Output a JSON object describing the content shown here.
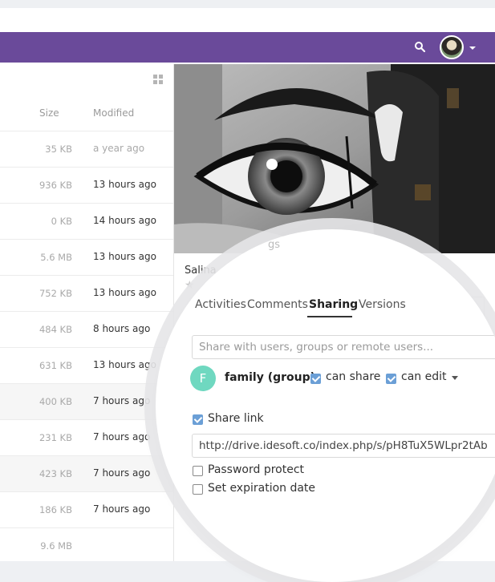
{
  "header": {
    "search_icon": "search-icon",
    "avatar_icon": "user-avatar",
    "menu_icon": "chevron-down-icon",
    "bar_color": "#6a4a9a"
  },
  "file_list": {
    "columns": {
      "size": "Size",
      "modified": "Modified"
    },
    "rows": [
      {
        "size": "35 KB",
        "modified": "a year ago"
      },
      {
        "size": "936 KB",
        "modified": "13 hours ago"
      },
      {
        "size": "0 KB",
        "modified": "14 hours ago"
      },
      {
        "size": "5.6 MB",
        "modified": "13 hours ago"
      },
      {
        "size": "752 KB",
        "modified": "13 hours ago"
      },
      {
        "size": "484 KB",
        "modified": "8 hours ago"
      },
      {
        "size": "631 KB",
        "modified": "13 hours ago"
      },
      {
        "size": "400 KB",
        "modified": "7 hours ago"
      },
      {
        "size": "231 KB",
        "modified": "7 hours ago"
      },
      {
        "size": "423 KB",
        "modified": "7 hours ago"
      },
      {
        "size": "186 KB",
        "modified": "7 hours ago"
      },
      {
        "size": "9.6 MB",
        "modified": ""
      }
    ]
  },
  "details": {
    "file_name": "Salina",
    "ghost_title": "gs",
    "star_icon": "star-icon",
    "tabs": [
      {
        "label": "Activities"
      },
      {
        "label": "Comments"
      },
      {
        "label": "Sharing"
      },
      {
        "label": "Versions"
      }
    ],
    "active_tab": "Sharing"
  },
  "sharing": {
    "share_placeholder": "Share with users, groups or remote users...",
    "share_entry": {
      "avatar_letter": "F",
      "avatar_color": "#6fd8c0",
      "name": "family (group)",
      "can_share_label": "can share",
      "can_share": true,
      "can_edit_label": "can edit",
      "can_edit": true
    },
    "share_link_label": "Share link",
    "share_link_enabled": true,
    "link_url": "http://drive.idesoft.co/index.php/s/pH8TuX5WLpr2tAb",
    "password_protect_label": "Password protect",
    "password_protect": false,
    "expiration_label": "Set expiration date",
    "expiration": false,
    "checkbox_color": "#6b9fd6"
  }
}
